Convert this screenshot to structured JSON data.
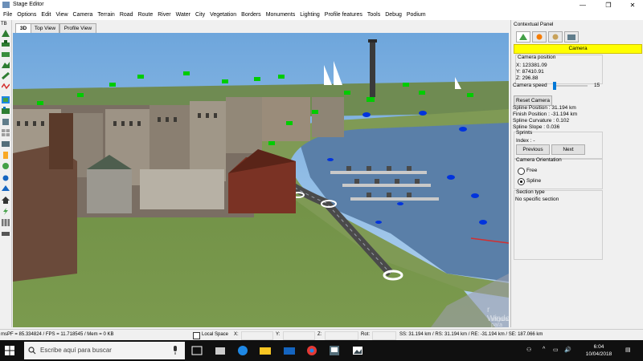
{
  "window": {
    "title": "Stage Editor",
    "minimize": "—",
    "maximize": "❐",
    "close": "✕"
  },
  "menu": [
    "File",
    "Options",
    "Edit",
    "View",
    "Camera",
    "Terrain",
    "Road",
    "Route",
    "River",
    "Water",
    "City",
    "Vegetation",
    "Borders",
    "Monuments",
    "Lighting",
    "Profile features",
    "Tools",
    "Debug",
    "Podium"
  ],
  "left_toolbar": {
    "label": "TB"
  },
  "view_tabs": [
    "3D",
    "Top View",
    "Profile View"
  ],
  "panel": {
    "title": "Contextual Panel",
    "active_section": "Camera",
    "camera_position": {
      "label": "Camera position",
      "x": "X: 123381.09",
      "y": "Y: 87410.91",
      "z": "Z: 296.88"
    },
    "camera_speed": {
      "label": "Camera speed",
      "value": "15"
    },
    "reset_camera": "Reset Camera",
    "spline_position": "Spline Position : 31.194 km",
    "finish_position": "Finish Position : -31.194 km",
    "spline_curvature": "Spline Curvature : 0.102",
    "spline_slope": "Spline Slope : 0.036",
    "sprints": {
      "label": "Sprints",
      "index": "Index : -",
      "previous": "Previous",
      "next": "Next"
    },
    "orientation": {
      "label": "Camera Orientation",
      "free": "Free",
      "spline": "Spline"
    },
    "section_type": {
      "label": "Section type",
      "value": "No specific section"
    }
  },
  "status": {
    "perf": "msPF = 85.334824 / FPS = 11.718545 / Mem = 0 KB",
    "local_space": "Local Space",
    "x": "X:",
    "y": "Y:",
    "z": "Z:",
    "rot": "Rot:",
    "distances": "SS: 31.194 km / RS: 31.194 km / RE: -31.194 km / SE: 187.066 km"
  },
  "watermark": {
    "line1": "r Windows",
    "line2": "nfiguración para activar Windows."
  },
  "taskbar": {
    "search_placeholder": "Escribe aquí para buscar",
    "time": "6:04",
    "date": "10/04/2018"
  },
  "colors": {
    "accent": "#0078d7",
    "highlight": "#ffff00",
    "flags": "#00cc00",
    "markers": "#0033dd"
  }
}
